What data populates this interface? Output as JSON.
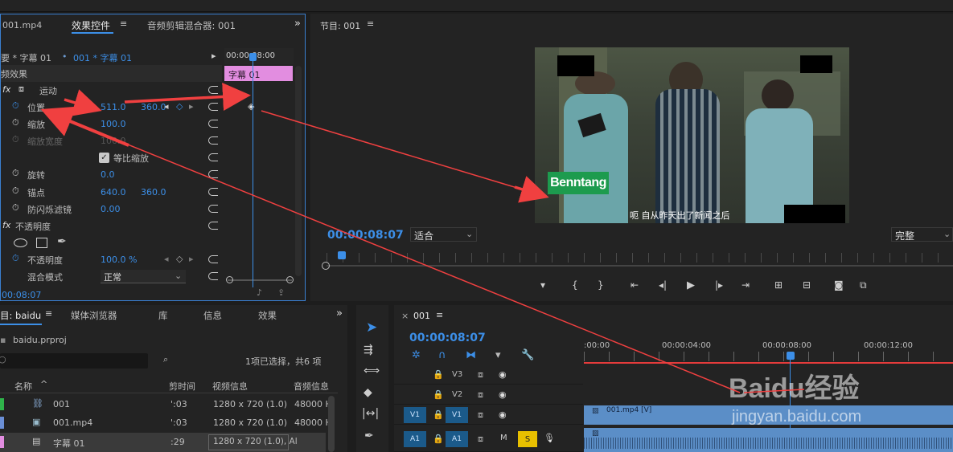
{
  "effect_controls": {
    "tab_source": "001.mp4",
    "tab_effects": "效果控件",
    "tab_mixer": "音频剪辑混合器: 001",
    "master_clip": "要 * 字幕 01",
    "sequence_clip": "001 * 字幕 01",
    "timecode_ruler": "00:00:08:00",
    "clip_bar_label": "字幕 01",
    "section_video": "频效果",
    "motion": "运动",
    "position_label": "位置",
    "position_x": "511.0",
    "position_y": "360.0",
    "scale_label": "缩放",
    "scale_value": "100.0",
    "scale_width_label": "缩放宽度",
    "scale_width_value": "100.0",
    "uniform_scale": "等比缩放",
    "rotation_label": "旋转",
    "rotation_value": "0.0",
    "anchor_label": "锚点",
    "anchor_x": "640.0",
    "anchor_y": "360.0",
    "flicker_label": "防闪烁滤镜",
    "flicker_value": "0.00",
    "opacity_section": "不透明度",
    "opacity_label": "不透明度",
    "opacity_value": "100.0 %",
    "blend_label": "混合模式",
    "blend_value": "正常",
    "timecode_bottom": "00:08:07"
  },
  "program": {
    "title": "节目: 001",
    "timecode": "00:00:08:07",
    "fit": "适合",
    "quality": "完整",
    "caption_logo": "Benntang",
    "subtitle": "呃 自从昨天出了新闻之后"
  },
  "project": {
    "tab_project": "目: baidu",
    "tab_media": "媒体浏览器",
    "tab_library": "库",
    "tab_info": "信息",
    "tab_effects": "效果",
    "file_name": "baidu.prproj",
    "selection": "1项已选择，共6 项",
    "col_name": "名称",
    "col_duration": "剪时间",
    "col_video": "视频信息",
    "col_audio": "音频信息",
    "items": [
      {
        "name": "001",
        "dur": "':03",
        "video": "1280 x 720 (1.0)",
        "audio": "48000 H:"
      },
      {
        "name": "001.mp4",
        "dur": "':03",
        "video": "1280 x 720 (1.0)",
        "audio": "48000 H:"
      },
      {
        "name": "字幕 01",
        "dur": ":29",
        "video": "1280 x 720 (1.0), Al",
        "audio": ""
      }
    ]
  },
  "timeline": {
    "tab": "001",
    "timecode": "00:00:08:07",
    "ruler": [
      ":00:00",
      "00:00:04:00",
      "00:00:08:00",
      "00:00:12:00"
    ],
    "tracks": [
      "V3",
      "V2",
      "V1",
      "A1"
    ],
    "source_v1": "V1",
    "source_a1": "A1",
    "clip_video": "001.mp4 [V]",
    "m": "M",
    "s": "S"
  },
  "watermark": {
    "brand": "Baidu经验",
    "url": "jingyan.baidu.com"
  },
  "colors": {
    "accent": "#3c8fe8",
    "arrow": "#f04040",
    "clip_title": "#e28de0",
    "clip_video": "#5b8ec7",
    "solo": "#e8c000"
  }
}
